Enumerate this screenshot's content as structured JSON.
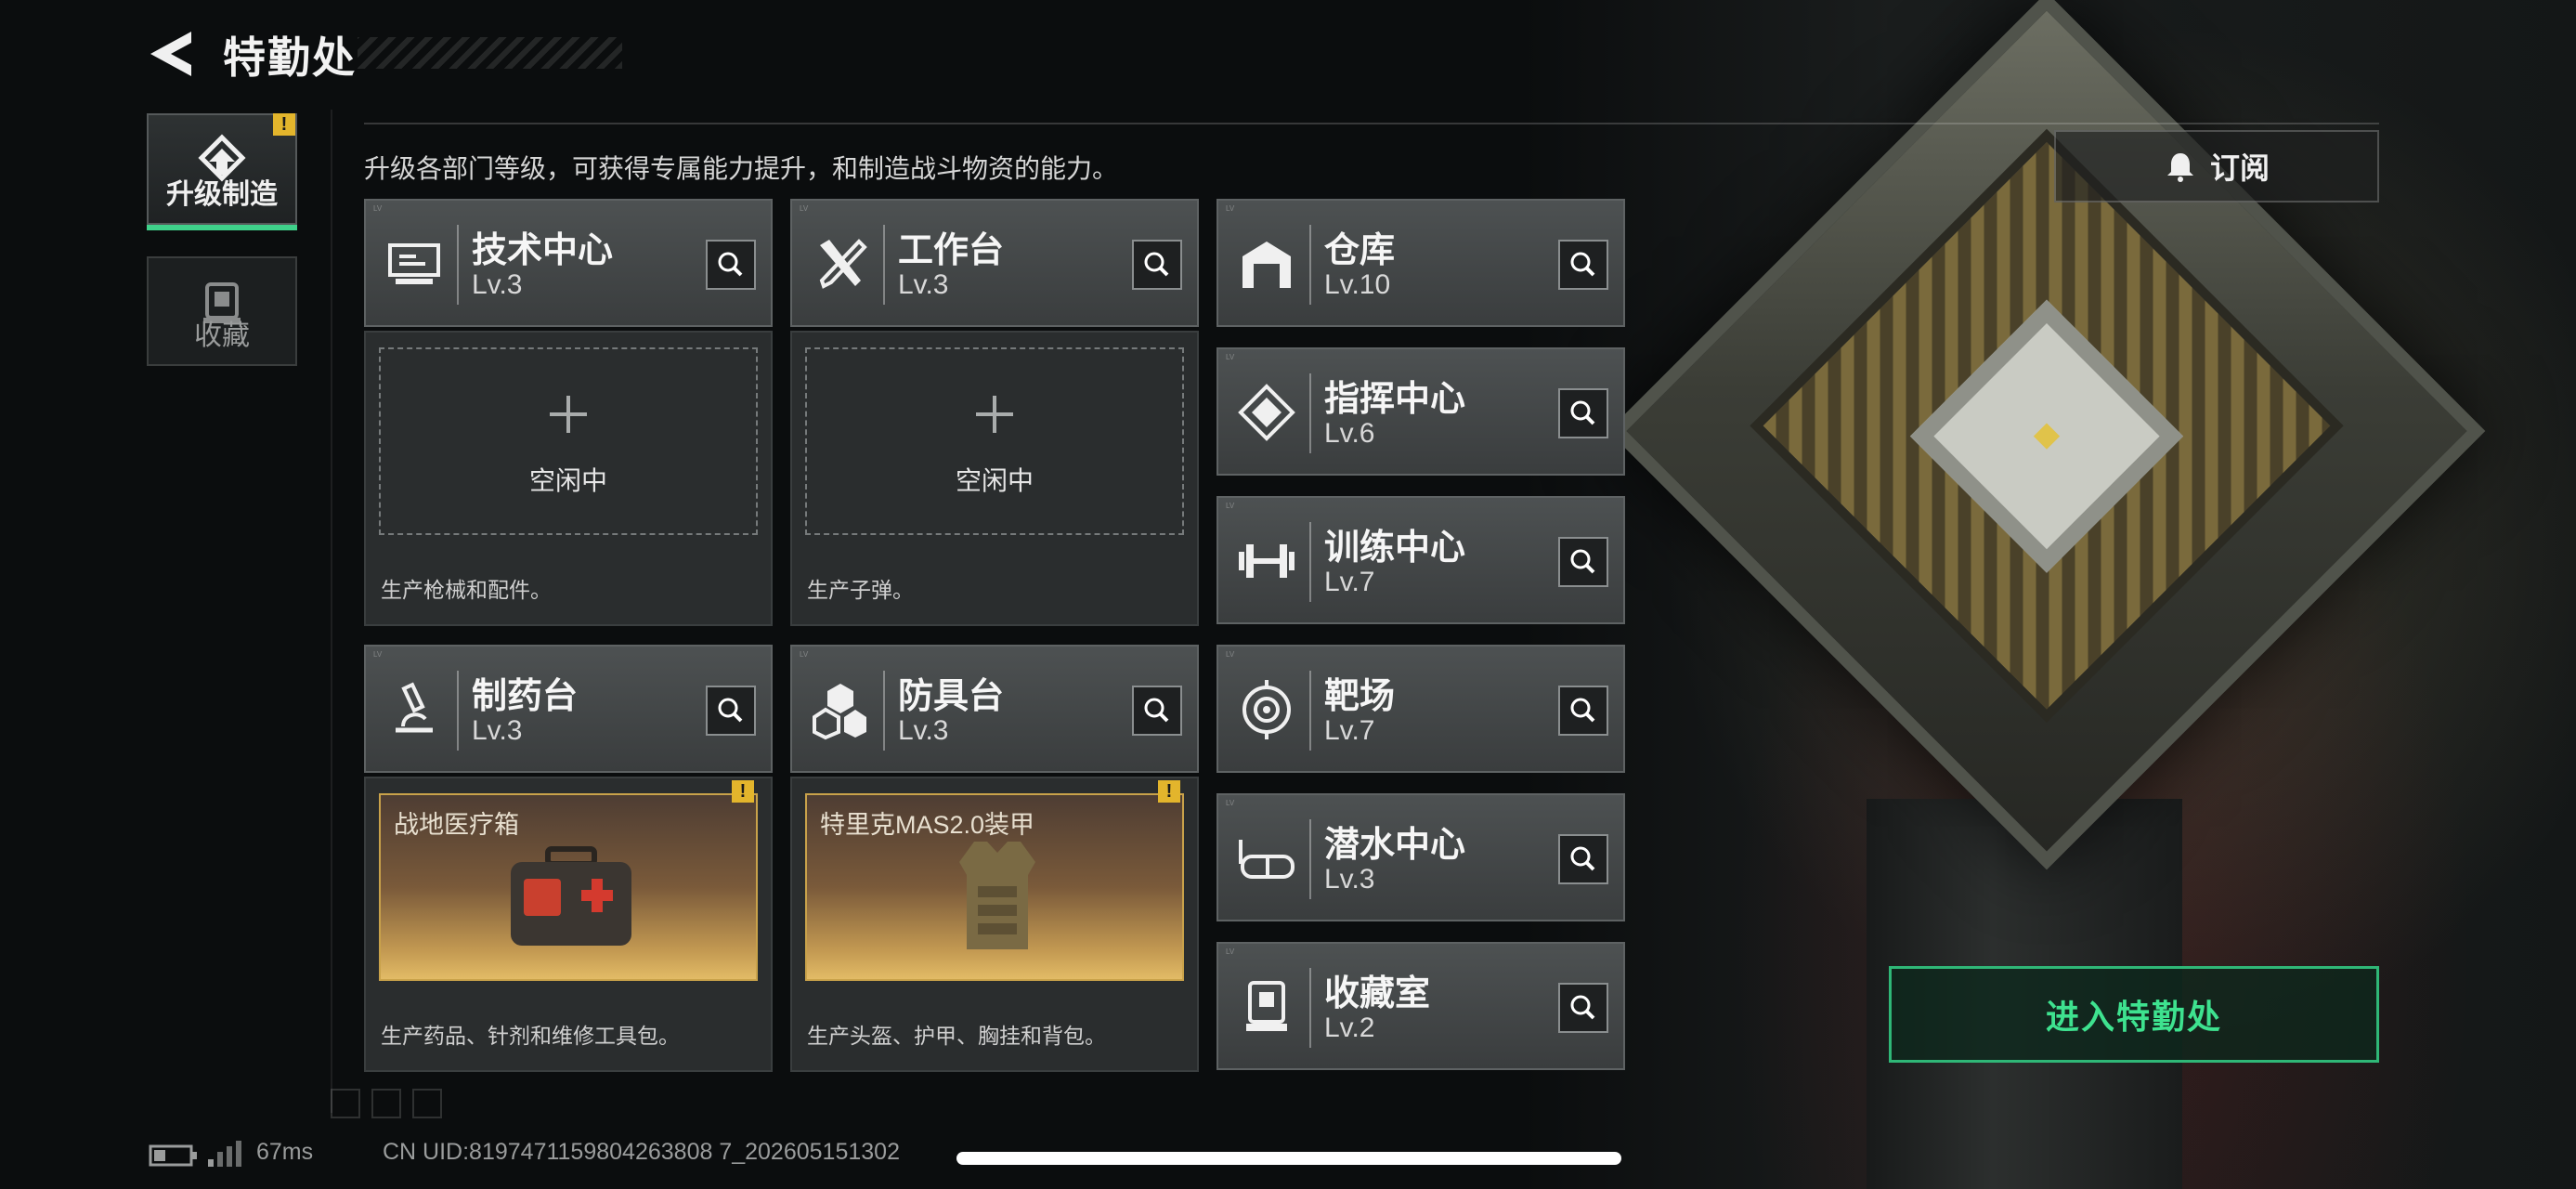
{
  "header": {
    "title": "特勤处"
  },
  "sidebar": {
    "tabs": [
      {
        "label": "升级制造",
        "active": true,
        "icon": "upgrade-icon",
        "alert": "!"
      },
      {
        "label": "收藏",
        "active": false,
        "icon": "collection-icon"
      }
    ]
  },
  "description": "升级各部门等级，可获得专属能力提升，和制造战斗物资的能力。",
  "subscribe_label": "订阅",
  "departments": [
    {
      "name": "技术中心",
      "level": "Lv.3",
      "icon": "monitor-icon"
    },
    {
      "name": "工作台",
      "level": "Lv.3",
      "icon": "tools-icon"
    },
    {
      "name": "仓库",
      "level": "Lv.10",
      "icon": "warehouse-icon"
    },
    {
      "name": "指挥中心",
      "level": "Lv.6",
      "icon": "command-chip-icon"
    },
    {
      "name": "训练中心",
      "level": "Lv.7",
      "icon": "dumbbell-icon"
    },
    {
      "name": "制药台",
      "level": "Lv.3",
      "icon": "microscope-icon"
    },
    {
      "name": "防具台",
      "level": "Lv.3",
      "icon": "cubes-icon"
    },
    {
      "name": "靶场",
      "level": "Lv.7",
      "icon": "target-icon"
    },
    {
      "name": "潜水中心",
      "level": "Lv.3",
      "icon": "goggles-icon"
    },
    {
      "name": "收藏室",
      "level": "Lv.2",
      "icon": "display-case-icon"
    }
  ],
  "production": [
    {
      "status": "空闲中",
      "note": "生产枪械和配件。"
    },
    {
      "status": "空闲中",
      "note": "生产子弹。"
    },
    {
      "item": "战地医疗箱",
      "note": "生产药品、针剂和维修工具包。",
      "alert": "!"
    },
    {
      "item": "特里克MAS2.0装甲",
      "note": "生产头盔、护甲、胸挂和背包。",
      "alert": "!"
    }
  ],
  "enter_button": "进入特勤处",
  "status_bar": {
    "ping": "67ms",
    "uid": "CN UID:8197471159804263808 7_202605151302"
  },
  "colors": {
    "accent_green": "#3ee28f",
    "warning_yellow": "#e3b52c"
  }
}
